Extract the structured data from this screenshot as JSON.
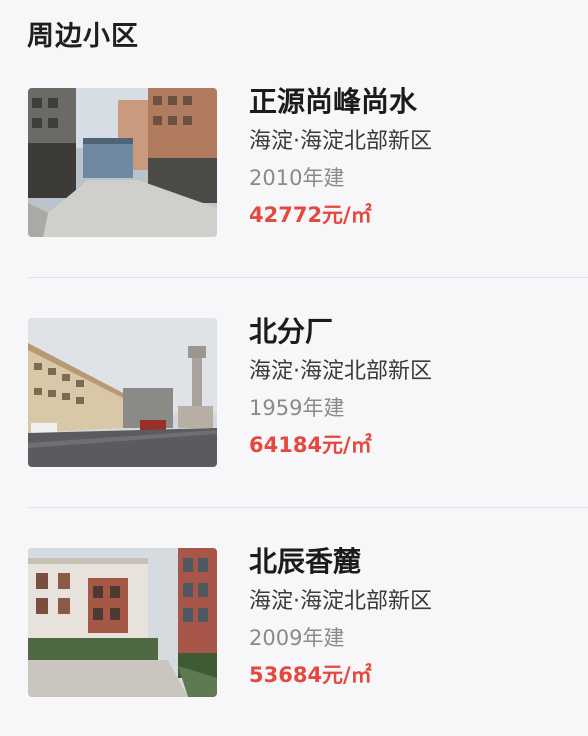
{
  "section": {
    "title": "周边小区"
  },
  "communities": [
    {
      "name": "正源尚峰尚水",
      "district": "海淀·海淀北部新区",
      "built": "2010年建",
      "price": "42772元/㎡"
    },
    {
      "name": "北分厂",
      "district": "海淀·海淀北部新区",
      "built": "1959年建",
      "price": "64184元/㎡"
    },
    {
      "name": "北辰香麓",
      "district": "海淀·海淀北部新区",
      "built": "2009年建",
      "price": "53684元/㎡"
    }
  ],
  "colors": {
    "price": "#e5483f",
    "title": "#1f1f1f",
    "background": "#f7f7f9",
    "divider": "#e3e4e8"
  }
}
